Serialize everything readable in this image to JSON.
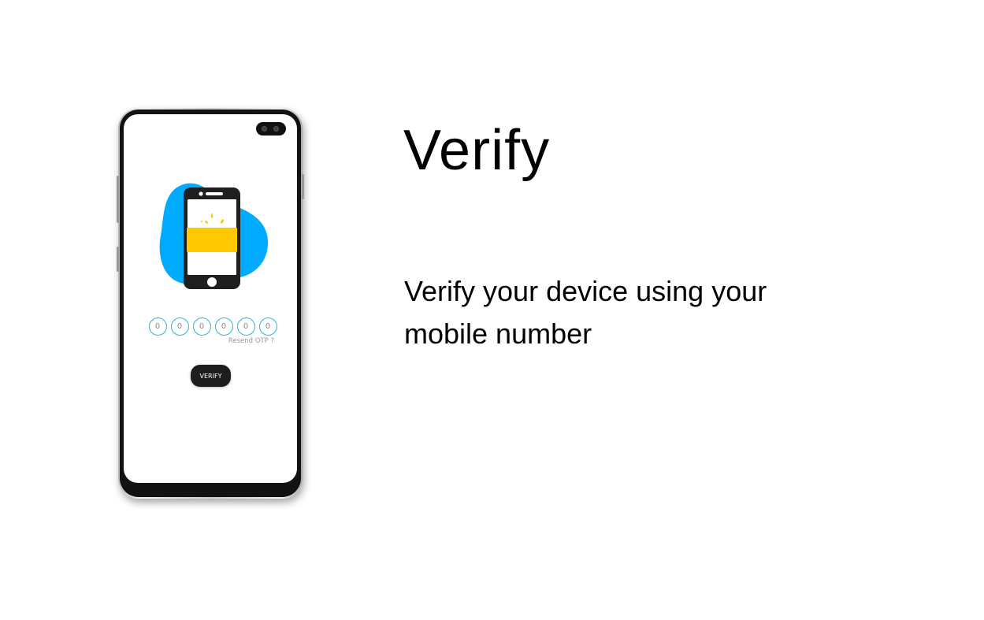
{
  "heading": {
    "title": "Verify",
    "description": "Verify your device using your mobile number"
  },
  "phone_mockup": {
    "otp_digits": [
      "0",
      "0",
      "0",
      "0",
      "0",
      "0"
    ],
    "resend_label": "Resend OTP ?",
    "verify_button_label": "VERIFY",
    "illustration_icon": "phone-verification-icon"
  },
  "colors": {
    "accent_blue": "#00aaff",
    "otp_border": "#29b6e8",
    "card_yellow": "#ffc800",
    "button_bg": "#1d1d1d",
    "text": "#000000"
  }
}
